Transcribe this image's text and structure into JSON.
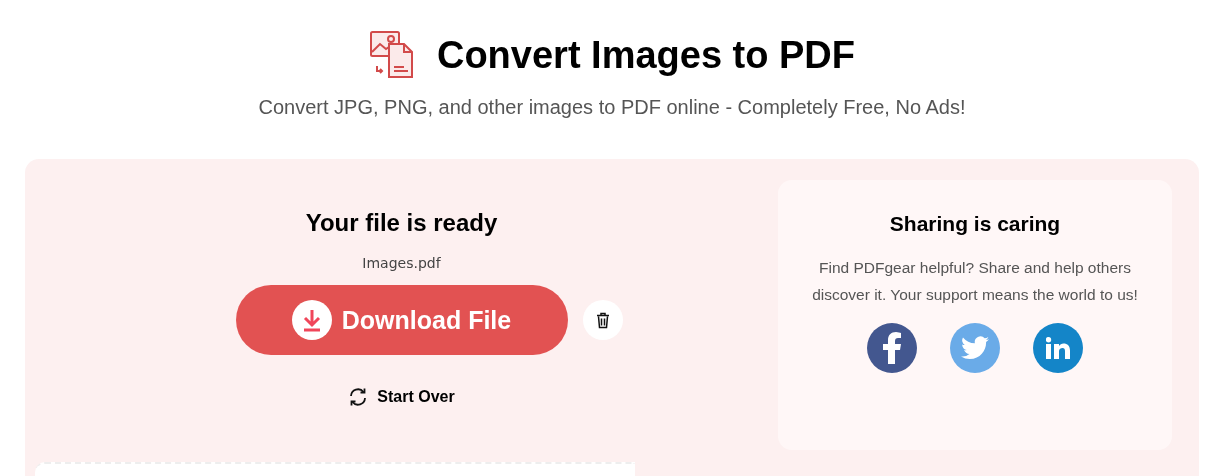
{
  "header": {
    "title": "Convert Images to PDF",
    "subtitle": "Convert JPG, PNG, and other images to PDF online - Completely Free, No Ads!"
  },
  "result": {
    "heading": "Your file is ready",
    "file_name": "Images.pdf",
    "download_label": "Download File",
    "start_over_label": "Start Over"
  },
  "share": {
    "heading": "Sharing is caring",
    "text": "Find PDFgear helpful? Share and help others discover it. Your support means the world to us!",
    "networks": [
      {
        "kind": "facebook",
        "color": "#43578f"
      },
      {
        "kind": "twitter",
        "color": "#6aabe8"
      },
      {
        "kind": "linkedin",
        "color": "#1485c8"
      }
    ]
  }
}
